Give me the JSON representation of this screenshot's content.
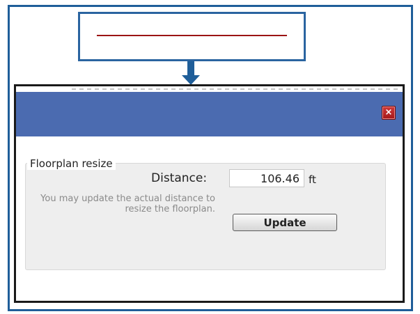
{
  "dialog": {
    "close_label": "×"
  },
  "floorplan": {
    "section_title": "Floorplan resize",
    "distance_label": "Distance:",
    "distance_value": "106.46",
    "unit": "ft",
    "help_text": "You may update the actual distance to resize the floorplan.",
    "update_label": "Update"
  },
  "colors": {
    "frame_border": "#1f5e99",
    "titlebar": "#4b6bb0",
    "callout_line": "#9b1414",
    "close_button": "#b82424"
  },
  "icons": {
    "close": "close-icon",
    "arrow": "down-arrow-icon"
  }
}
